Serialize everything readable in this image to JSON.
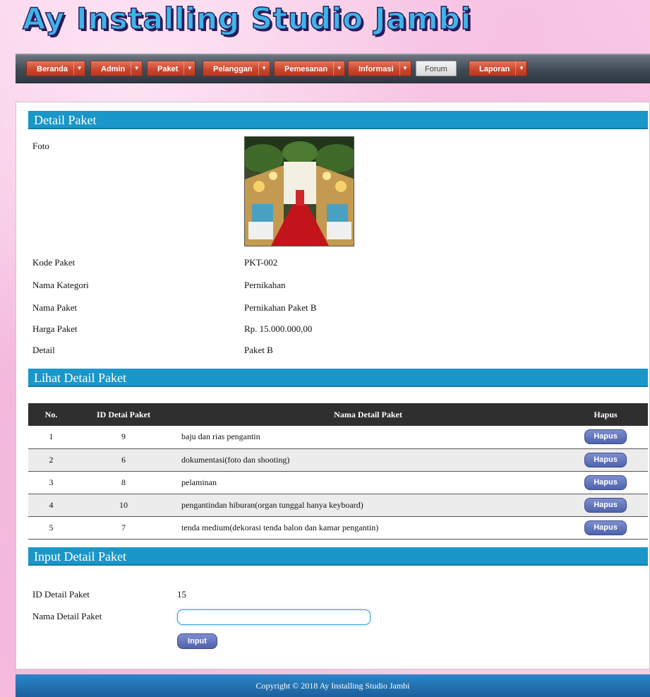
{
  "site": {
    "logo_text": "Ay Installing Studio Jambi"
  },
  "nav": {
    "beranda": "Beranda",
    "admin": "Admin",
    "paket": "Paket",
    "pelanggan": "Pelanggan",
    "pemesanan": "Pemesanan",
    "informasi": "Informasi",
    "forum": "Forum",
    "laporan": "Laporan",
    "caret": "▼"
  },
  "detail": {
    "title": "Detail Paket",
    "foto_label": "Foto",
    "kode_label": "Kode Paket",
    "kode_value": "PKT-002",
    "kategori_label": "Nama Kategori",
    "kategori_value": "Pernikahan",
    "nama_label": "Nama Paket",
    "nama_value": "Pernikahan Paket B",
    "harga_label": "Harga Paket",
    "harga_value": "Rp. 15.000.000,00",
    "detail_label": "Detail",
    "detail_value": "Paket B"
  },
  "lihat": {
    "title": "Lihat Detail Paket",
    "columns": {
      "no": "No.",
      "id": "ID Detai Paket",
      "nama": "Nama Detail Paket",
      "hapus": "Hapus"
    },
    "button_label": "Hapus",
    "rows": [
      {
        "no": "1",
        "id": "9",
        "nama": "baju dan rias pengantin"
      },
      {
        "no": "2",
        "id": "6",
        "nama": "dokumentasi(foto dan shooting)"
      },
      {
        "no": "3",
        "id": "8",
        "nama": "pelaminan"
      },
      {
        "no": "4",
        "id": "10",
        "nama": "pengantindan hiburan(organ tunggal hanya keyboard)"
      },
      {
        "no": "5",
        "id": "7",
        "nama": "tenda medium(dekorasi tenda balon dan kamar pengantin)"
      }
    ]
  },
  "input": {
    "title": "Input Detail Paket",
    "id_label": "ID Detail Paket",
    "id_value": "15",
    "nama_label": "Nama Detail Paket",
    "nama_value": "",
    "button_label": "Input"
  },
  "footer": {
    "text": "Copyright © 2018 Ay Installing Studio Jambi"
  },
  "colors": {
    "section_bar": "#1a97c9",
    "nav_button": "#c9452b",
    "action_button": "#4f63ad",
    "footer": "#1c5f9c"
  }
}
